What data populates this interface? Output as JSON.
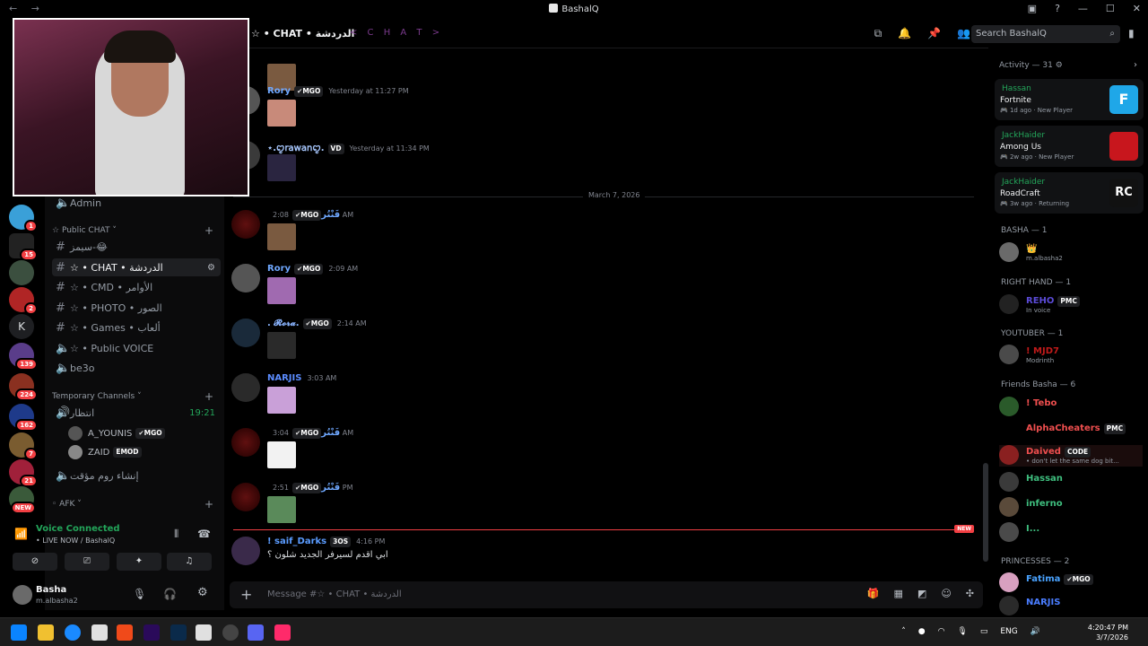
{
  "window": {
    "title": "BashalQ"
  },
  "header": {
    "channel": "☆ • CHAT • الدردشة",
    "deco": "< C H A T >"
  },
  "search": {
    "placeholder": "Search BashalQ"
  },
  "sidebar": {
    "admin": "Admin",
    "cat_public_chat": "Public CHAT",
    "channels": [
      "سيمز-😂",
      "☆ • CHAT • الدردشة",
      "☆ • CMD • الأوامر",
      "☆ • PHOTO • الصور",
      "☆ • Games • ألعاب",
      "☆ • Public VOICE",
      "be3o"
    ],
    "cat_temporary": "Temporary Channels",
    "voice_channel": "انتظار",
    "voice_timer": "19:21",
    "voice_users": [
      {
        "name": "A_YOUNIS",
        "tag": "MGO"
      },
      {
        "name": "ZAID",
        "tag": "EMOD"
      }
    ],
    "create_room": "إنشاء روم مؤقت",
    "cat_afk": "AFK"
  },
  "voice": {
    "status": "Voice Connected",
    "sub": "• LIVE NOW / BashalQ"
  },
  "user": {
    "name": "Basha",
    "handle": "m.albasha2"
  },
  "chat": {
    "date_divider": "March 7, 2026",
    "new_label": "NEW",
    "messages": [
      {
        "user": "Rory",
        "tag": "MGO",
        "time": "Yesterday at 11:27 PM",
        "color": "#6fa8ff"
      },
      {
        "user": "⋆.ꨄ𝗋𝖺𝗐𝖺𝗇ꨄ.",
        "tag": "VD",
        "time": "Yesterday at 11:34 PM",
        "color": "#a8c8ff"
      },
      {
        "user": "فَنْتُر",
        "tag": "MGO",
        "time": "2:08 AM",
        "color": "#6fa8ff"
      },
      {
        "user": "Rory",
        "tag": "MGO",
        "time": "2:09 AM",
        "color": "#6fa8ff"
      },
      {
        "user": ". 𝓡𝓸𝓻𝓪.",
        "tag": "MGO",
        "time": "2:14 AM",
        "color": "#8ab4ff"
      },
      {
        "user": "NARJIS",
        "tag": "",
        "time": "3:03 AM",
        "color": "#5b8cff"
      },
      {
        "user": "فَنْتُر",
        "tag": "MGO",
        "time": "3:04 AM",
        "color": "#6fa8ff"
      },
      {
        "user": "فَنْتُر",
        "tag": "MGO",
        "time": "2:51 PM",
        "color": "#6fa8ff"
      },
      {
        "user": "! saif_Darks",
        "tag": "3OS",
        "time": "4:16 PM",
        "color": "#5b9cff",
        "text": "ابي اقدم لسيرفر الجديد شلون ؟"
      }
    ]
  },
  "composer": {
    "placeholder": "Message #☆ • CHAT • الدردشة"
  },
  "activity": {
    "header": "Activity — 31",
    "cards": [
      {
        "who": "Hassan",
        "game": "Fortnite",
        "ago": "1d ago",
        "status": "New Player",
        "thumb": "F",
        "color": "#1fa7e8"
      },
      {
        "who": "JackHaider",
        "game": "Among Us",
        "ago": "2w ago",
        "status": "New Player",
        "thumb": "",
        "color": "#c8161d"
      },
      {
        "who": "JackHaider",
        "game": "RoadCraft",
        "ago": "3w ago",
        "status": "Returning",
        "thumb": "RC",
        "color": "#111"
      }
    ]
  },
  "members": {
    "roles": [
      "BASHA — 1",
      "RIGHT HAND — 1",
      "YOUTUBER — 1",
      "Friends Basha — 6",
      "PRINCESSES — 2"
    ],
    "basha": {
      "sub": "m.albasha2"
    },
    "right_hand": {
      "name": "REHO",
      "tag": "PMC",
      "sub": "In voice"
    },
    "youtuber": {
      "name": "! MJD7",
      "sub": "Modrinth"
    },
    "friends": [
      {
        "name": "! Tebo",
        "color": "#f04f4f"
      },
      {
        "name": "AlphaCheaters",
        "color": "#f04f4f",
        "tag": "PMC"
      },
      {
        "name": "Daived",
        "color": "#f04f4f",
        "tag": "CODE",
        "sub": "• don't let the same dog bit..."
      },
      {
        "name": "Hassan",
        "color": "#3fbf7f"
      },
      {
        "name": "inferno",
        "color": "#3fbf7f"
      },
      {
        "name": "I...",
        "color": "#3fbf7f"
      }
    ],
    "princesses": [
      {
        "name": "Fatima",
        "color": "#4aa3ff",
        "tag": "MGO"
      },
      {
        "name": "NARJIS",
        "color": "#4a7dff"
      }
    ]
  },
  "taskbar": {
    "lang": "ENG",
    "time": "4:20:47 PM",
    "date": "3/7/2026"
  },
  "server_badges": [
    "1",
    "15",
    "2",
    "139",
    "224",
    "162",
    "7",
    "21",
    "NEW"
  ]
}
